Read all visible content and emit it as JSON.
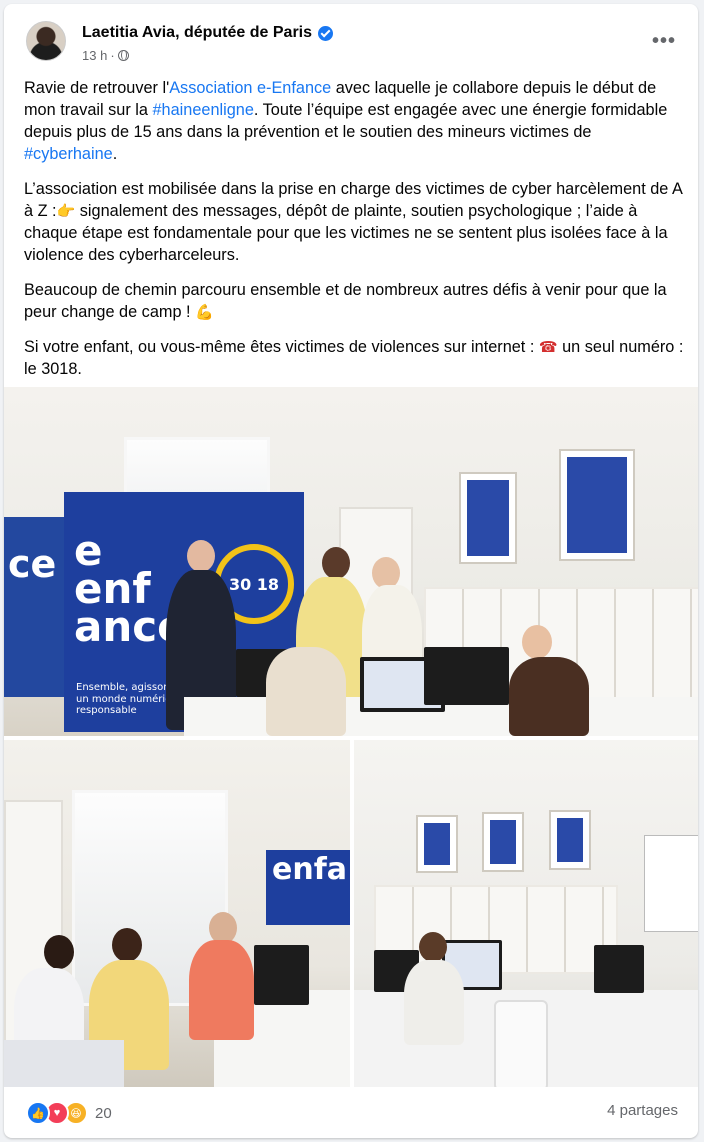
{
  "post": {
    "author": "Laetitia Avia, députée de Paris",
    "time": "13 h",
    "separator": "·",
    "more_label": "•••",
    "paragraphs": {
      "p1": {
        "t1": "Ravie de retrouver l'",
        "link1": "Association e-Enfance",
        "t2": " avec laquelle je collabore depuis le début de mon travail sur la ",
        "link2": "#haineenligne",
        "t3": ". Toute l’équipe est engagée avec une énergie formidable depuis plus de 15 ans dans la prévention et le soutien des mineurs victimes de ",
        "link3": "#cyberhaine",
        "t4": "."
      },
      "p2": {
        "t1": "L’association est mobilisée dans la prise en charge des victimes de cyber harcèlement de A à Z :",
        "emoji": "👉",
        "t2": " signalement des messages, dépôt de plainte, soutien psychologique ; l’aide à chaque étape est fondamentale pour que les victimes ne se sentent plus isolées face à la violence des cyberharceleurs."
      },
      "p3": {
        "t1": "Beaucoup de chemin parcouru ensemble et de nombreux autres défis à venir pour que la peur change de camp ! ",
        "emoji": "💪"
      },
      "p4": {
        "t1": "Si votre enfant, ou vous-même êtes victimes de violences sur internet : ",
        "emoji": "☎",
        "t2": " un seul numéro : le 3018."
      }
    },
    "photo_text": {
      "logo": "e\nenf\nance",
      "logo_short": "enfa",
      "hotline": "30 18",
      "banner_tagline": "Ensemble, agissons pour un monde numérique responsable",
      "side_banner": "ce"
    },
    "reactions": {
      "icons": [
        "like-icon",
        "love-icon",
        "haha-icon"
      ],
      "count": "20",
      "shares": "4 partages"
    },
    "colors": {
      "link": "#1877f2",
      "secondary_text": "#65676b",
      "brand_blue": "#1e3f9e",
      "brand_yellow": "#f2c318"
    }
  }
}
